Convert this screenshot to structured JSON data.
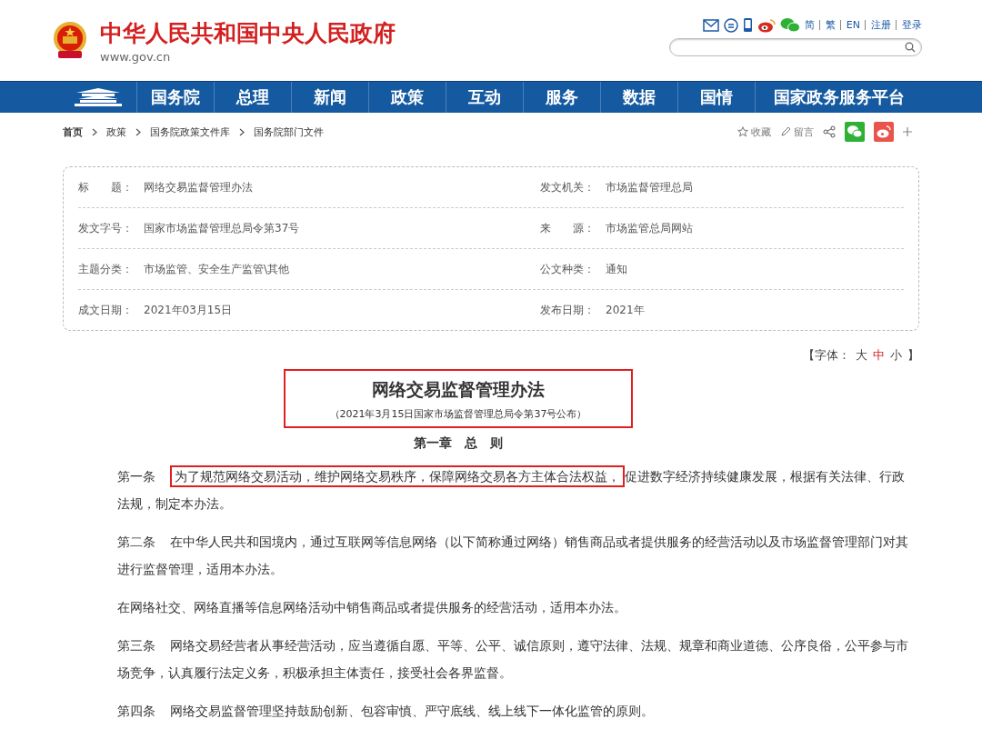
{
  "header": {
    "site_name": "中华人民共和国中央人民政府",
    "domain": "www.gov.cn",
    "links": [
      "简",
      "繁",
      "EN",
      "注册",
      "登录"
    ]
  },
  "nav": [
    {
      "label": "国务院"
    },
    {
      "label": "总理"
    },
    {
      "label": "新闻"
    },
    {
      "label": "政策"
    },
    {
      "label": "互动"
    },
    {
      "label": "服务"
    },
    {
      "label": "数据"
    },
    {
      "label": "国情"
    },
    {
      "label": "国家政务服务平台"
    }
  ],
  "breadcrumb": [
    "首页",
    "政策",
    "国务院政策文件库",
    "国务院部门文件"
  ],
  "tools": {
    "favorite": "收藏",
    "comment": "留言"
  },
  "meta": [
    [
      {
        "label": "标　　题：",
        "value": "网络交易监督管理办法"
      },
      {
        "label": "发文机关：",
        "value": "市场监督管理总局"
      }
    ],
    [
      {
        "label": "发文字号：",
        "value": "国家市场监督管理总局令第37号"
      },
      {
        "label": "来　　源：",
        "value": "市场监管总局网站"
      }
    ],
    [
      {
        "label": "主题分类：",
        "value": "市场监管、安全生产监管\\其他"
      },
      {
        "label": "公文种类：",
        "value": "通知"
      }
    ],
    [
      {
        "label": "成文日期：",
        "value": "2021年03月15日"
      },
      {
        "label": "发布日期：",
        "value": "2021年"
      }
    ]
  ],
  "font_size": {
    "open": "【字体：",
    "options": [
      {
        "label": "大",
        "selected": false
      },
      {
        "label": "中",
        "selected": true
      },
      {
        "label": "小",
        "selected": false
      }
    ],
    "close": "】"
  },
  "document": {
    "title": "网络交易监督管理办法",
    "subtitle": "（2021年3月15日国家市场监督管理总局令第37号公布）",
    "chapter": "第一章　总　则",
    "paragraphs": [
      {
        "label": "第一条",
        "parts": [
          {
            "text": "为了规范网络交易活动，维护网络交易秩序，保障网络交易各方主体合法权益，",
            "highlighted": true
          },
          {
            "text": "促进数字经济持续健康发展，根据有关法律、行政法规，制定本办法。",
            "highlighted": false
          }
        ]
      },
      {
        "label": "第二条",
        "parts": [
          {
            "text": "在中华人民共和国境内，通过互联网等信息网络（以下简称通过网络）销售商品或者提供服务的经营活动以及市场监督管理部门对其进行监督管理，适用本办法。",
            "highlighted": false
          }
        ]
      },
      {
        "parts": [
          {
            "text": "在网络社交、网络直播等信息网络活动中销售商品或者提供服务的经营活动，适用本办法。",
            "highlighted": false
          }
        ]
      },
      {
        "label": "第三条",
        "parts": [
          {
            "text": "网络交易经营者从事经营活动，应当遵循自愿、平等、公平、诚信原则，遵守法律、法规、规章和商业道德、公序良俗，公平参与市场竞争，认真履行法定义务，积极承担主体责任，接受社会各界监督。",
            "highlighted": false
          }
        ]
      },
      {
        "label": "第四条",
        "parts": [
          {
            "text": "网络交易监督管理坚持鼓励创新、包容审慎、严守底线、线上线下一体化监管的原则。",
            "highlighted": false
          }
        ]
      }
    ]
  }
}
